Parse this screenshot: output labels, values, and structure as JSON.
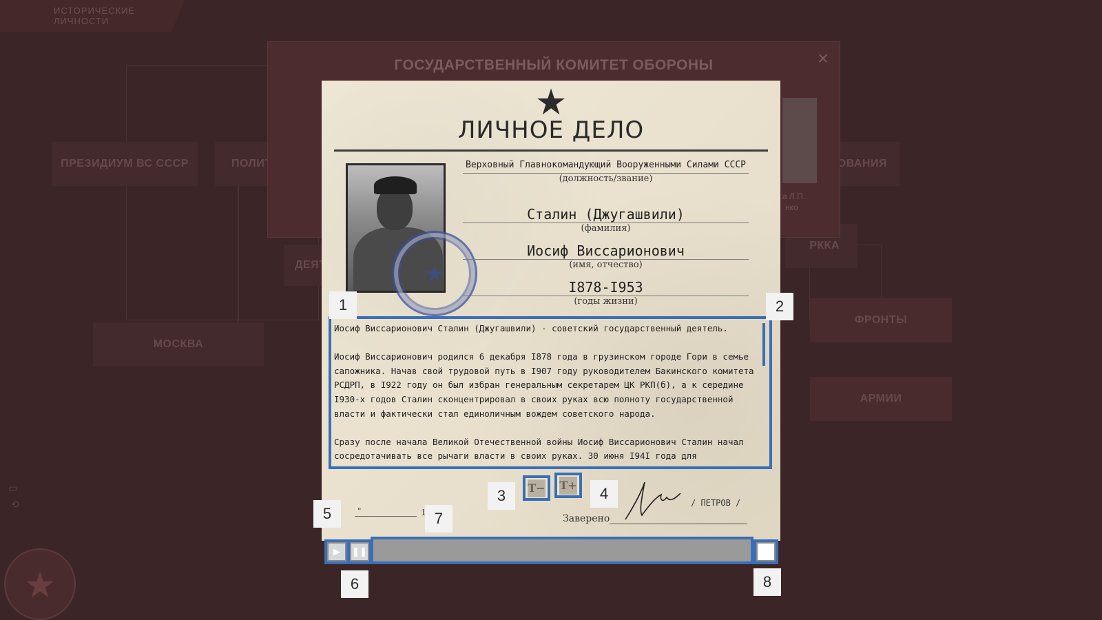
{
  "background": {
    "tab_label": "ИСТОРИЧЕСКИЕ ЛИЧНОСТИ",
    "panel_title": "ГОСУДАРСТВЕННЫЙ КОМИТЕТ ОБОРОНЫ",
    "close_icon": "close-icon",
    "nodes": [
      "ПРЕЗИДИУМ ВС СССР",
      "ПОЛИТ",
      "ДЕЯТ",
      "МОСКВА",
      "ДОВАНИЯ",
      "РККА",
      "ФРОНТЫ",
      "АРМИИ"
    ],
    "caption_lines": [
      "а Л.П.",
      "нко"
    ]
  },
  "document": {
    "title": "ЛИЧНОЕ ДЕЛО",
    "emblem_icon": "star-hammer-sickle-icon",
    "position_value": "Верховный Главнокомандующий Вооруженными Силами СССР",
    "position_label": "(должность/звание)",
    "surname_value": "Сталин (Джугашвили)",
    "surname_label": "(фамилия)",
    "name_value": "Иосиф Виссарионович",
    "name_label": "(имя, отчество)",
    "years_value": "I878-I953",
    "years_label": "(годы жизни)",
    "bio_paragraphs": [
      "Иосиф Виссарионович Сталин (Джугашвили) - советский государственный деятель.",
      "Иосиф Виссарионович родился 6 декабря I878 года в грузинском городе Гори в семье сапожника. Начав свой трудовой путь в I907 году руководителем Бакинского комитета РСДРП, в I922 году он был избран генеральным секретарем ЦК РКП(б), а к середине I930-х годов Сталин сконцентрировал в своих руках всю полноту государственной власти и фактически стал единоличным вождем советского народа.",
      "Сразу после начала Великой Отечественной войны Иосиф Виссарионович Сталин начал сосредотачивать все рычаги власти в своих руках. 30 июня I94I года для мобилизации всех сил страны на отпор агрессору создается Государственный Комитет Обороны"
    ],
    "text_decrease_label": "T−",
    "text_increase_label": "T+",
    "date_quote": "\"",
    "date_year_prefix": "19",
    "certified_label": "Заверено",
    "signer": "/ ПЕТРОВ /"
  },
  "player": {
    "play_icon": "play-icon",
    "pause_icon": "pause-icon",
    "stop_icon": "stop-icon",
    "progress": 0
  },
  "callouts": [
    "1",
    "2",
    "3",
    "4",
    "5",
    "6",
    "7",
    "8"
  ]
}
